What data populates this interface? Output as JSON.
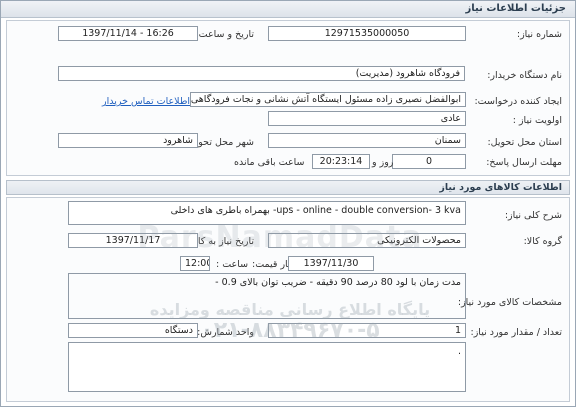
{
  "header": {
    "title": "جزئیات اطلاعات نیاز"
  },
  "need_info": {
    "need_number": {
      "label": "شماره نیاز:",
      "value": "12971535000050"
    },
    "announce_datetime": {
      "label": "تاریخ و ساعت اعلان عمومی:",
      "value": "1397/11/14 - 16:26"
    },
    "buyer_org": {
      "label": "نام دستگاه خریدار:",
      "value": "فرودگاه شاهرود (مدیریت)"
    },
    "requester": {
      "label": "ایجاد کننده درخواست:",
      "value": "ابوالفضل نصیری زاده مسئول ایستگاه آتش نشانی و نجات فرودگاهی فرودگاه شاهرود",
      "contact_link": "اطلاعات تماس خریدار"
    },
    "priority": {
      "label": "اولویت نیاز :",
      "value": "عادی"
    },
    "province": {
      "label": "استان محل تحویل:",
      "value": "سمنان"
    },
    "city": {
      "label": "شهر محل تحویل:",
      "value": "شاهرود"
    },
    "deadline": {
      "label": "مهلت ارسال پاسخ:",
      "days": "0",
      "days_label": "روز و",
      "time": "20:23:14",
      "remaining_label": "ساعت باقی مانده"
    }
  },
  "goods_section": {
    "title": "اطلاعات کالاهای مورد نیاز",
    "summary": {
      "label": "شرح کلی نیاز:",
      "value": "ups - online - double conversion- 3 kva- بهمراه باطری های داخلی"
    },
    "goods_group": {
      "label": "گروه کالا:",
      "value": "محصولات الکترونیکی"
    },
    "need_date": {
      "label": "تاریخ نیاز به کالا:",
      "value": "1397/11/17"
    },
    "price_validity": {
      "label": "حداکثر تاریخ اعتبار قیمت:",
      "date": "1397/11/30",
      "time_label": "ساعت :",
      "time": "12:00"
    },
    "specs": {
      "label": "مشخصات کالای مورد نیاز:",
      "value": "مدت زمان با لود 80 درصد 90 دقیقه - ضریب توان بالای 0.9 -"
    },
    "quantity": {
      "label": "تعداد / مقدار مورد نیاز:",
      "value": "1",
      "unit_label": "واحد شمارش:",
      "unit": "دستگاه"
    },
    "notes": {
      "value": "."
    }
  },
  "watermark": {
    "brand": "ParsNamadData",
    "line1": "پایگاه اطلاع رسانی مناقصه ومزایده",
    "line2": "۰۲۱-۸۸۳۴۹۶۷۰-۵"
  }
}
